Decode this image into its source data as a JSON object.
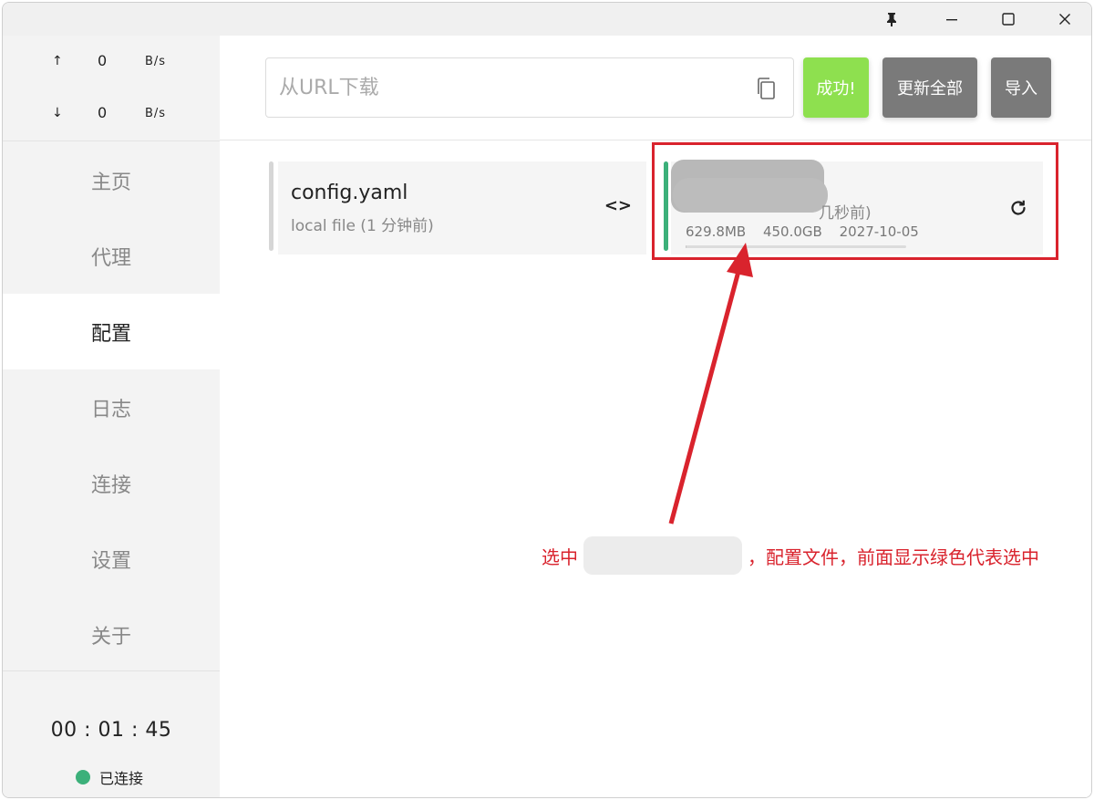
{
  "titlebar": {
    "pin_icon": "pin-icon",
    "minimize_icon": "minimize-icon",
    "maximize_icon": "maximize-icon",
    "close_icon": "close-icon"
  },
  "traffic": {
    "up_arrow": "↑",
    "up_value": "0",
    "up_unit": "B/s",
    "down_arrow": "↓",
    "down_value": "0",
    "down_unit": "B/s"
  },
  "sidebar": {
    "items": [
      {
        "label": "主页",
        "active": false
      },
      {
        "label": "代理",
        "active": false
      },
      {
        "label": "配置",
        "active": true
      },
      {
        "label": "日志",
        "active": false
      },
      {
        "label": "连接",
        "active": false
      },
      {
        "label": "设置",
        "active": false
      },
      {
        "label": "关于",
        "active": false
      }
    ],
    "timer": "00 : 01 : 45",
    "status": "已连接",
    "status_color": "#3cb07a"
  },
  "toolbar": {
    "url_placeholder": "从URL下载",
    "url_value": "",
    "success_label": "成功!",
    "update_all_label": "更新全部",
    "import_label": "导入",
    "success_color": "#8ee04f"
  },
  "profiles": [
    {
      "title": "config.yaml",
      "subtitle": "local file (1 分钟前)",
      "selected": false
    },
    {
      "time_suffix": "几秒前)",
      "used": "629.8MB",
      "total": "450.0GB",
      "expire": "2027-10-05",
      "usage_fraction": 0.0014,
      "selected": true,
      "accent_color": "#3cb07a"
    }
  ],
  "annotation": {
    "prefix": "选中",
    "suffix": "，配置文件，前面显示绿色代表选中",
    "color": "#d9232d"
  }
}
